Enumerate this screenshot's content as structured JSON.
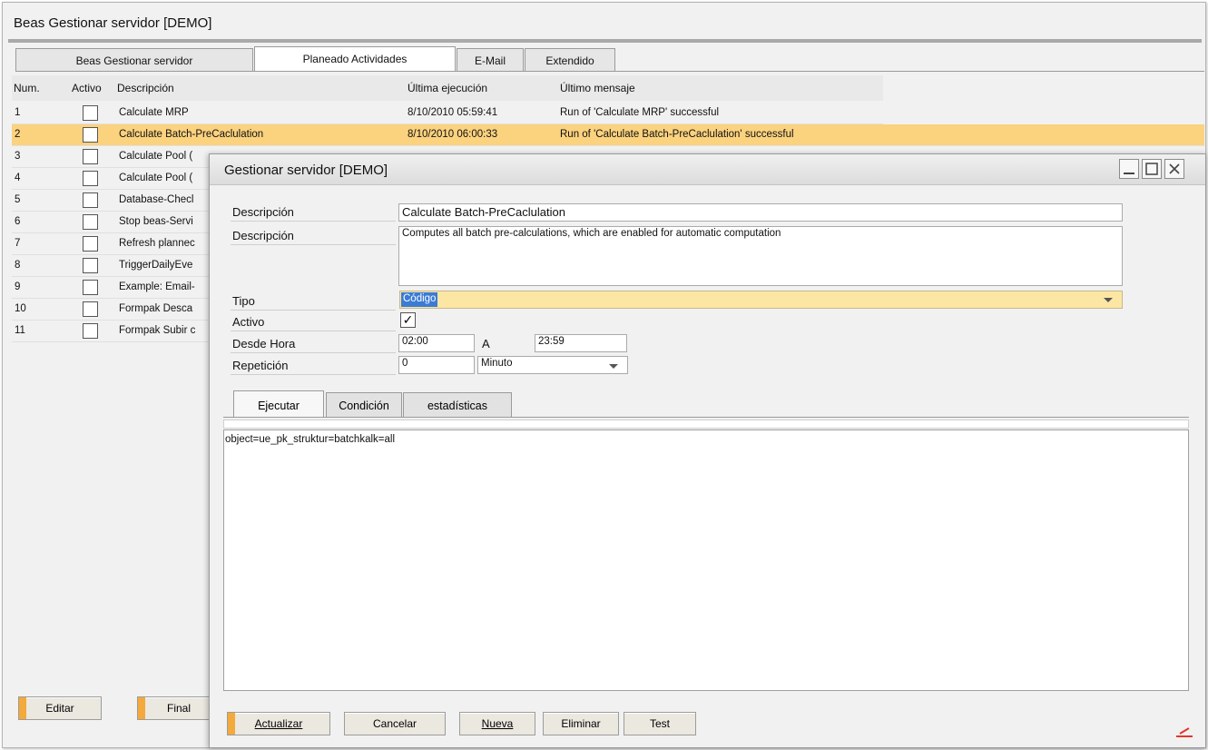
{
  "outer": {
    "title": "Beas Gestionar servidor [DEMO]",
    "tabs": [
      "Beas Gestionar servidor",
      "Planeado Actividades",
      "E-Mail",
      "Extendido"
    ],
    "active_tab": "Planeado Actividades",
    "grid": {
      "headers": [
        "Num.",
        "Activo",
        "Descripción",
        "Última ejecución",
        "Último mensaje"
      ],
      "rows": [
        {
          "num": "1",
          "desc": "Calculate MRP",
          "last_run": "8/10/2010 05:59:41",
          "last_msg": "Run of 'Calculate MRP' successful"
        },
        {
          "num": "2",
          "desc": "Calculate Batch-PreCaclulation",
          "last_run": "8/10/2010 06:00:33",
          "last_msg": "Run of 'Calculate Batch-PreCaclulation' successful"
        },
        {
          "num": "3",
          "desc": "Calculate Pool (",
          "last_run": "",
          "last_msg": ""
        },
        {
          "num": "4",
          "desc": "Calculate Pool (",
          "last_run": "",
          "last_msg": ""
        },
        {
          "num": "5",
          "desc": "Database-Checl",
          "last_run": "",
          "last_msg": ""
        },
        {
          "num": "6",
          "desc": "Stop beas-Servi",
          "last_run": "",
          "last_msg": ""
        },
        {
          "num": "7",
          "desc": "Refresh plannec",
          "last_run": "",
          "last_msg": ""
        },
        {
          "num": "8",
          "desc": "TriggerDailyEve",
          "last_run": "",
          "last_msg": ""
        },
        {
          "num": "9",
          "desc": "Example: Email-",
          "last_run": "",
          "last_msg": ""
        },
        {
          "num": "10",
          "desc": "Formpak Desca",
          "last_run": "",
          "last_msg": ""
        },
        {
          "num": "11",
          "desc": "Formpak Subir c",
          "last_run": "",
          "last_msg": ""
        }
      ]
    },
    "buttons": {
      "edit": "Editar",
      "final": "Final"
    }
  },
  "dialog": {
    "title": "Gestionar servidor [DEMO]",
    "window_buttons": {
      "minimize": "_",
      "maximize": "□",
      "close": "✕"
    },
    "fields": {
      "desc_label": "Descripción",
      "desc_value": "Calculate Batch-PreCaclulation",
      "desc2_label": "Descripción",
      "desc2_value": "Computes all batch pre-calculations, which are enabled for automatic computation",
      "tipo_label": "Tipo",
      "tipo_value": "Código",
      "activo_label": "Activo",
      "activo_check": "✓",
      "desde_label": "Desde Hora",
      "desde_value": "02:00",
      "a_label": "A",
      "a_value": "23:59",
      "rep_label": "Repetición",
      "rep_value": "0",
      "rep_unit": "Minuto"
    },
    "tabs": [
      "Ejecutar",
      "Condición",
      "estadísticas"
    ],
    "active_tab": "Ejecutar",
    "code": "object=ue_pk_struktur=batchkalk=all",
    "buttons": {
      "update": "Actualizar",
      "cancel": "Cancelar",
      "new": "Nueva",
      "delete": "Eliminar",
      "test": "Test"
    }
  },
  "colors": {
    "selection": "#fbd27e",
    "accent": "#f3a93b",
    "highlight": "#3a7bd5"
  }
}
